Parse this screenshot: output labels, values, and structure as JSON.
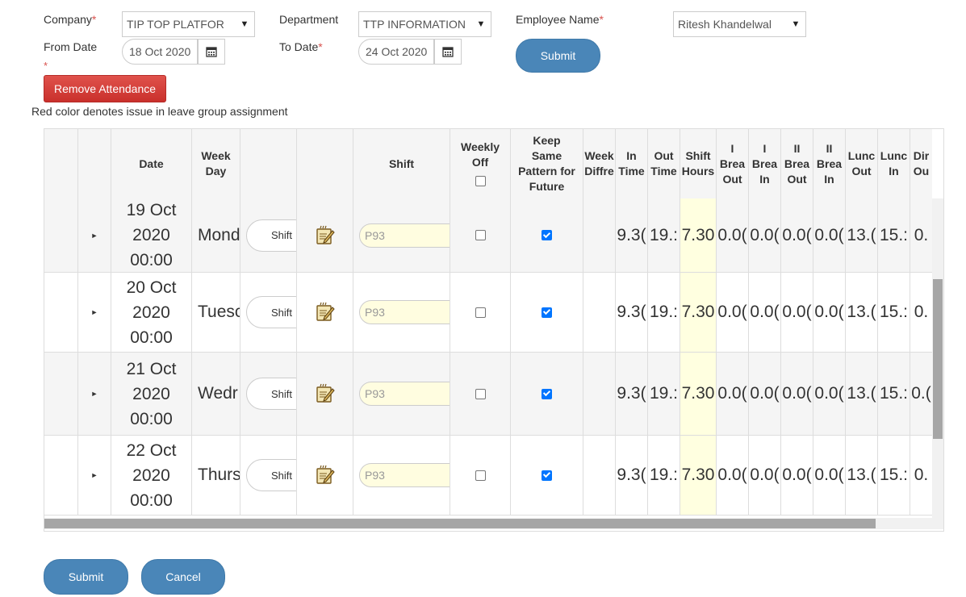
{
  "filters": {
    "company_label": "Company",
    "company_value": "TIP TOP PLATFOR",
    "department_label": "Department",
    "department_value": "TTP INFORMATION",
    "employee_label": "Employee Name",
    "employee_value": "Ritesh Khandelwal",
    "from_date_label": "From Date",
    "from_date_value": "18 Oct 2020",
    "to_date_label": "To Date",
    "to_date_value": "24 Oct 2020",
    "required_mark": "*",
    "submit_label": "Submit"
  },
  "remove_attendance_label": "Remove Attendance",
  "note": "Red color denotes issue in leave group assignment",
  "grid": {
    "headers": {
      "date": "Date",
      "week_day": [
        "Week",
        "Day"
      ],
      "shift": "Shift",
      "weekly_off": [
        "Weekly",
        "Off"
      ],
      "keep_same": [
        "Keep",
        "Same",
        "Pattern for",
        "Future"
      ],
      "week_diff": [
        "Week",
        "Diffre"
      ],
      "in_time": [
        "In",
        "Time"
      ],
      "out_time": [
        "Out",
        "Time"
      ],
      "shift_hours": [
        "Shift",
        "Hours"
      ],
      "break1_out": [
        "I",
        "Brea",
        "Out"
      ],
      "break1_in": [
        "I",
        "Brea",
        "In"
      ],
      "break2_out": [
        "II",
        "Brea",
        "Out"
      ],
      "break2_in": [
        "II",
        "Brea",
        "In"
      ],
      "lunch_out": [
        "Lunc",
        "Out"
      ],
      "lunch_in": [
        "Lunc",
        "In"
      ],
      "dinner_out": [
        "Dir",
        "Ou"
      ]
    },
    "rows": [
      {
        "date": [
          "19 Oct",
          "2020",
          "00:00"
        ],
        "week_day": "Mond",
        "shift_btn": "Shift",
        "shift_value": "P93",
        "weekly_off": false,
        "keep_same": true,
        "in_time": "9.3(",
        "out_time": "19.:",
        "shift_hours": "7.30",
        "b1_out": "0.0(",
        "b1_in": "0.0(",
        "b2_out": "0.0(",
        "b2_in": "0.0(",
        "lunch_out": "13.(",
        "lunch_in": "15.:",
        "dinner_out": "0."
      },
      {
        "date": [
          "20 Oct",
          "2020",
          "00:00"
        ],
        "week_day": "Tuesc",
        "shift_btn": "Shift",
        "shift_value": "P93",
        "weekly_off": false,
        "keep_same": true,
        "in_time": "9.3(",
        "out_time": "19.:",
        "shift_hours": "7.30",
        "b1_out": "0.0(",
        "b1_in": "0.0(",
        "b2_out": "0.0(",
        "b2_in": "0.0(",
        "lunch_out": "13.(",
        "lunch_in": "15.:",
        "dinner_out": "0."
      },
      {
        "date": [
          "21 Oct",
          "2020",
          "00:00"
        ],
        "week_day": "Wedr",
        "shift_btn": "Shift",
        "shift_value": "P93",
        "weekly_off": false,
        "keep_same": true,
        "in_time": "9.3(",
        "out_time": "19.:",
        "shift_hours": "7.30",
        "b1_out": "0.0(",
        "b1_in": "0.0(",
        "b2_out": "0.0(",
        "b2_in": "0.0(",
        "lunch_out": "13.(",
        "lunch_in": "15.:",
        "dinner_out": "0.("
      },
      {
        "date": [
          "22 Oct",
          "2020",
          "00:00"
        ],
        "week_day": "Thurs",
        "shift_btn": "Shift",
        "shift_value": "P93",
        "weekly_off": false,
        "keep_same": true,
        "in_time": "9.3(",
        "out_time": "19.:",
        "shift_hours": "7.30",
        "b1_out": "0.0(",
        "b1_in": "0.0(",
        "b2_out": "0.0(",
        "b2_in": "0.0(",
        "lunch_out": "13.(",
        "lunch_in": "15.:",
        "dinner_out": "0."
      }
    ]
  },
  "footer": {
    "submit_label": "Submit",
    "cancel_label": "Cancel"
  },
  "colors": {
    "primary_button": "#4a86b8",
    "danger_button": "#d9534f",
    "shift_hours_highlight": "#ffffe0",
    "shift_input_bg": "#fffde0"
  }
}
